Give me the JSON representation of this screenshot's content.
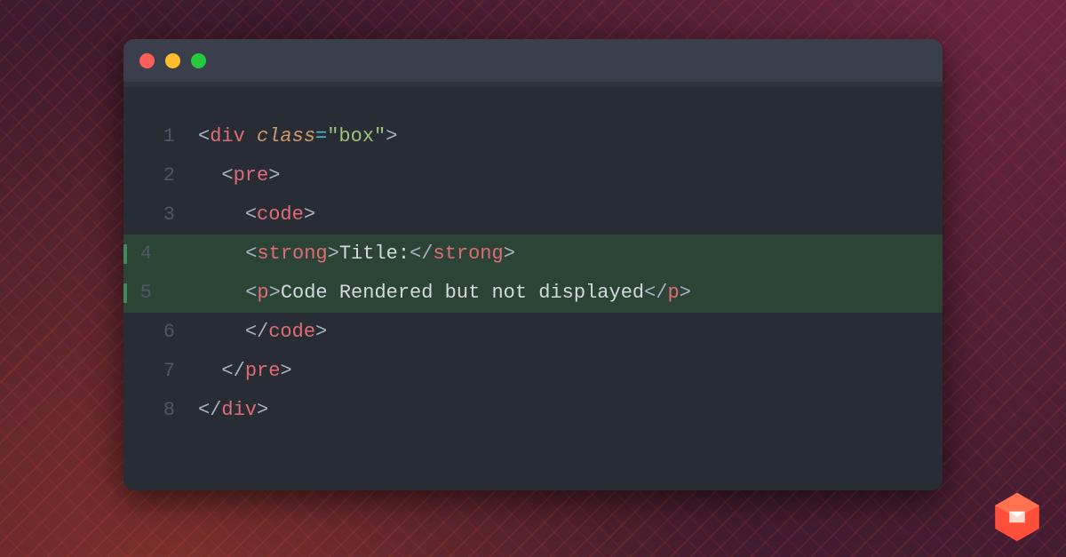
{
  "lines": {
    "l1n": "1",
    "l2n": "2",
    "l3n": "3",
    "l4n": "4",
    "l5n": "5",
    "l6n": "6",
    "l7n": "7",
    "l8n": "8"
  },
  "tokens": {
    "lt": "<",
    "gt": ">",
    "lts": "</",
    "div": "div",
    "pre": "pre",
    "code": "code",
    "strong": "strong",
    "p": "p",
    "class_attr": "class",
    "eq": "=",
    "box_str": "\"box\"",
    "title_txt": "Title:",
    "line5_txt": "Code Rendered but not displayed"
  },
  "indent": {
    "i0": "",
    "i1": "  ",
    "i2": "    ",
    "i3": "      "
  },
  "colors": {
    "window_bg": "#282c34",
    "titlebar_bg": "#3a3f4b",
    "red": "#ff5f56",
    "yellow": "#ffbd2e",
    "green": "#27c93f",
    "highlight": "#2b4436"
  }
}
